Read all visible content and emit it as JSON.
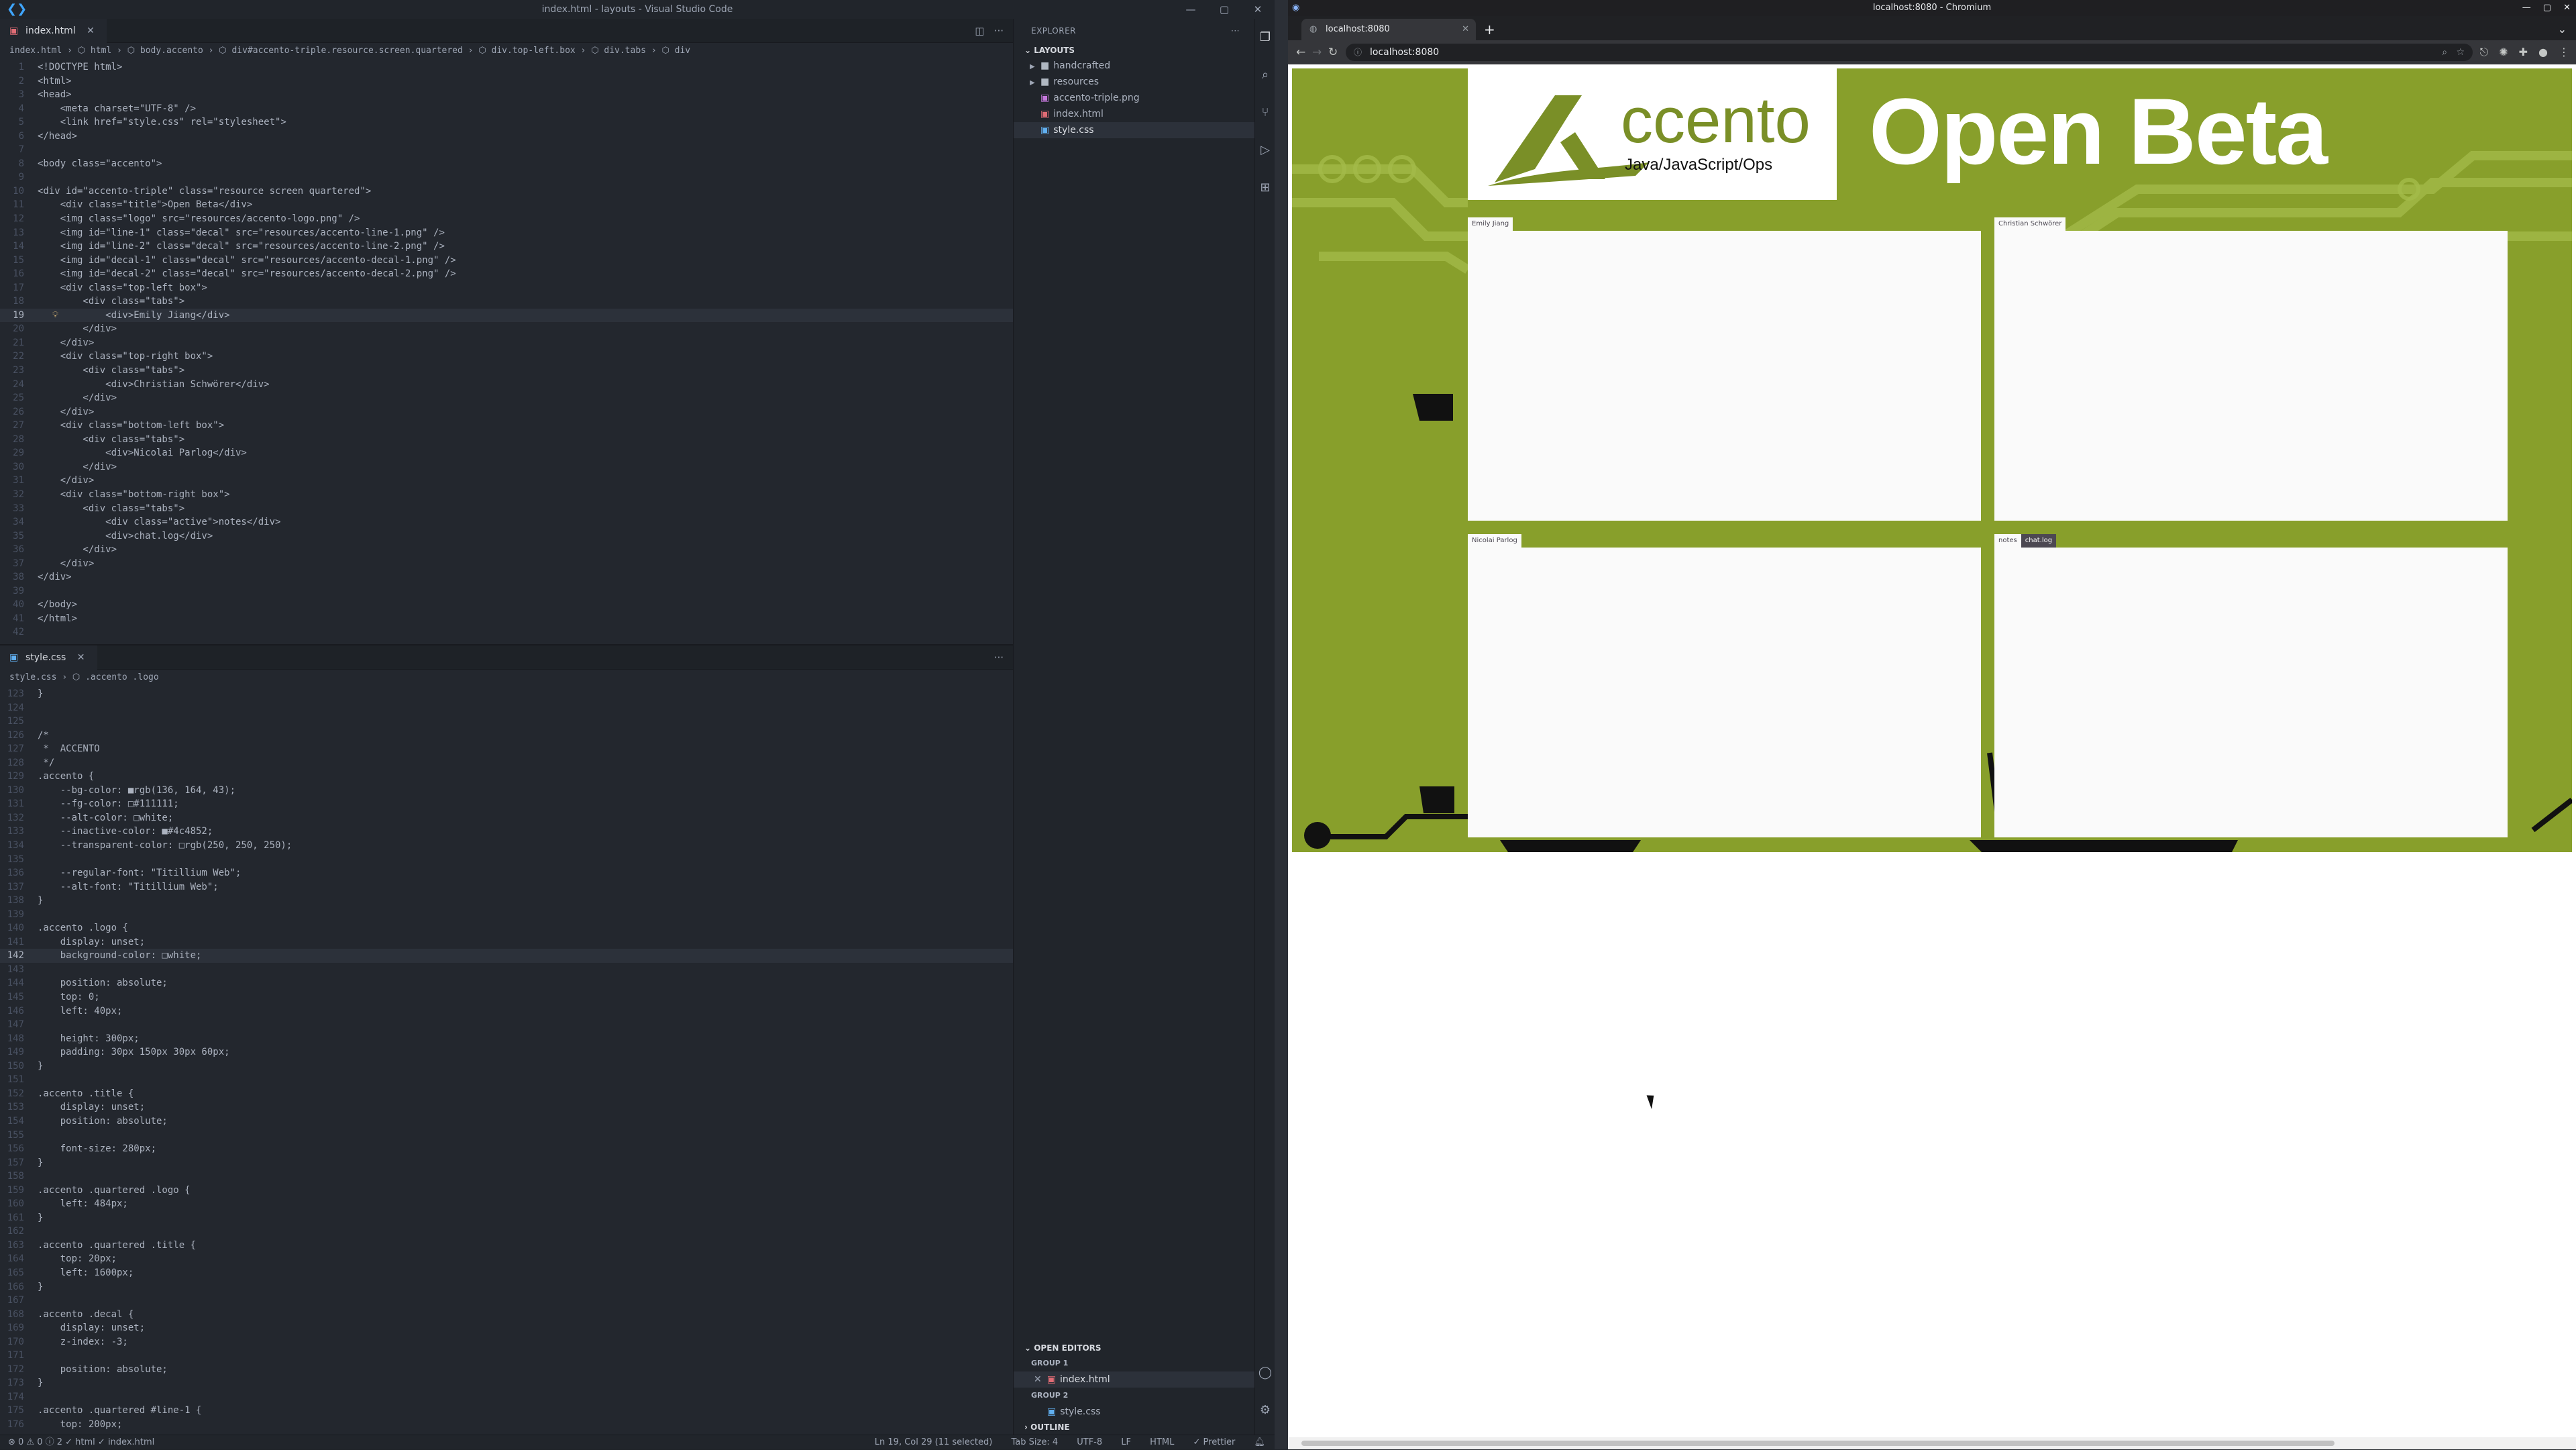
{
  "vscode": {
    "window_title": "index.html - layouts - Visual Studio Code",
    "top_editor": {
      "tab": "index.html",
      "breadcrumbs": "index.html  ›  ⬡ html  ›  ⬡ body.accento  ›  ⬡ div#accento-triple.resource.screen.quartered  ›  ⬡ div.top-left.box  ›  ⬡ div.tabs  ›  ⬡ div",
      "lines": [
        {
          "n": "1",
          "t": "<!DOCTYPE html>"
        },
        {
          "n": "2",
          "t": "<html>"
        },
        {
          "n": "3",
          "t": "<head>"
        },
        {
          "n": "4",
          "t": "    <meta charset=\"UTF-8\" />"
        },
        {
          "n": "5",
          "t": "    <link href=\"style.css\" rel=\"stylesheet\">"
        },
        {
          "n": "6",
          "t": "</head>"
        },
        {
          "n": "7",
          "t": ""
        },
        {
          "n": "8",
          "t": "<body class=\"accento\">"
        },
        {
          "n": "9",
          "t": ""
        },
        {
          "n": "10",
          "t": "<div id=\"accento-triple\" class=\"resource screen quartered\">"
        },
        {
          "n": "11",
          "t": "    <div class=\"title\">Open Beta</div>"
        },
        {
          "n": "12",
          "t": "    <img class=\"logo\" src=\"resources/accento-logo.png\" />"
        },
        {
          "n": "13",
          "t": "    <img id=\"line-1\" class=\"decal\" src=\"resources/accento-line-1.png\" />"
        },
        {
          "n": "14",
          "t": "    <img id=\"line-2\" class=\"decal\" src=\"resources/accento-line-2.png\" />"
        },
        {
          "n": "15",
          "t": "    <img id=\"decal-1\" class=\"decal\" src=\"resources/accento-decal-1.png\" />"
        },
        {
          "n": "16",
          "t": "    <img id=\"decal-2\" class=\"decal\" src=\"resources/accento-decal-2.png\" />"
        },
        {
          "n": "17",
          "t": "    <div class=\"top-left box\">"
        },
        {
          "n": "18",
          "t": "        <div class=\"tabs\">"
        },
        {
          "n": "19",
          "t": "            <div>Emily Jiang</div>"
        },
        {
          "n": "20",
          "t": "        </div>"
        },
        {
          "n": "21",
          "t": "    </div>"
        },
        {
          "n": "22",
          "t": "    <div class=\"top-right box\">"
        },
        {
          "n": "23",
          "t": "        <div class=\"tabs\">"
        },
        {
          "n": "24",
          "t": "            <div>Christian Schwörer</div>"
        },
        {
          "n": "25",
          "t": "        </div>"
        },
        {
          "n": "26",
          "t": "    </div>"
        },
        {
          "n": "27",
          "t": "    <div class=\"bottom-left box\">"
        },
        {
          "n": "28",
          "t": "        <div class=\"tabs\">"
        },
        {
          "n": "29",
          "t": "            <div>Nicolai Parlog</div>"
        },
        {
          "n": "30",
          "t": "        </div>"
        },
        {
          "n": "31",
          "t": "    </div>"
        },
        {
          "n": "32",
          "t": "    <div class=\"bottom-right box\">"
        },
        {
          "n": "33",
          "t": "        <div class=\"tabs\">"
        },
        {
          "n": "34",
          "t": "            <div class=\"active\">notes</div>"
        },
        {
          "n": "35",
          "t": "            <div>chat.log</div>"
        },
        {
          "n": "36",
          "t": "        </div>"
        },
        {
          "n": "37",
          "t": "    </div>"
        },
        {
          "n": "38",
          "t": "</div>"
        },
        {
          "n": "39",
          "t": ""
        },
        {
          "n": "40",
          "t": "</body>"
        },
        {
          "n": "41",
          "t": "</html>"
        },
        {
          "n": "42",
          "t": ""
        }
      ]
    },
    "bottom_editor": {
      "tab": "style.css",
      "breadcrumbs": "style.css  ›  ⬡ .accento .logo",
      "lines": [
        {
          "n": "123",
          "t": "}"
        },
        {
          "n": "124",
          "t": ""
        },
        {
          "n": "125",
          "t": ""
        },
        {
          "n": "126",
          "t": "/*"
        },
        {
          "n": "127",
          "t": " *  ACCENTO"
        },
        {
          "n": "128",
          "t": " */"
        },
        {
          "n": "129",
          "t": ".accento {"
        },
        {
          "n": "130",
          "t": "    --bg-color: ■rgb(136, 164, 43);"
        },
        {
          "n": "131",
          "t": "    --fg-color: □#111111;"
        },
        {
          "n": "132",
          "t": "    --alt-color: □white;"
        },
        {
          "n": "133",
          "t": "    --inactive-color: ■#4c4852;"
        },
        {
          "n": "134",
          "t": "    --transparent-color: □rgb(250, 250, 250);"
        },
        {
          "n": "135",
          "t": ""
        },
        {
          "n": "136",
          "t": "    --regular-font: \"Titillium Web\";"
        },
        {
          "n": "137",
          "t": "    --alt-font: \"Titillium Web\";"
        },
        {
          "n": "138",
          "t": "}"
        },
        {
          "n": "139",
          "t": ""
        },
        {
          "n": "140",
          "t": ".accento .logo {"
        },
        {
          "n": "141",
          "t": "    display: unset;"
        },
        {
          "n": "142",
          "t": "    background-color: □white;"
        },
        {
          "n": "143",
          "t": ""
        },
        {
          "n": "144",
          "t": "    position: absolute;"
        },
        {
          "n": "145",
          "t": "    top: 0;"
        },
        {
          "n": "146",
          "t": "    left: 40px;"
        },
        {
          "n": "147",
          "t": ""
        },
        {
          "n": "148",
          "t": "    height: 300px;"
        },
        {
          "n": "149",
          "t": "    padding: 30px 150px 30px 60px;"
        },
        {
          "n": "150",
          "t": "}"
        },
        {
          "n": "151",
          "t": ""
        },
        {
          "n": "152",
          "t": ".accento .title {"
        },
        {
          "n": "153",
          "t": "    display: unset;"
        },
        {
          "n": "154",
          "t": "    position: absolute;"
        },
        {
          "n": "155",
          "t": ""
        },
        {
          "n": "156",
          "t": "    font-size: 280px;"
        },
        {
          "n": "157",
          "t": "}"
        },
        {
          "n": "158",
          "t": ""
        },
        {
          "n": "159",
          "t": ".accento .quartered .logo {"
        },
        {
          "n": "160",
          "t": "    left: 484px;"
        },
        {
          "n": "161",
          "t": "}"
        },
        {
          "n": "162",
          "t": ""
        },
        {
          "n": "163",
          "t": ".accento .quartered .title {"
        },
        {
          "n": "164",
          "t": "    top: 20px;"
        },
        {
          "n": "165",
          "t": "    left: 1600px;"
        },
        {
          "n": "166",
          "t": "}"
        },
        {
          "n": "167",
          "t": ""
        },
        {
          "n": "168",
          "t": ".accento .decal {"
        },
        {
          "n": "169",
          "t": "    display: unset;"
        },
        {
          "n": "170",
          "t": "    z-index: -3;"
        },
        {
          "n": "171",
          "t": ""
        },
        {
          "n": "172",
          "t": "    position: absolute;"
        },
        {
          "n": "173",
          "t": "}"
        },
        {
          "n": "174",
          "t": ""
        },
        {
          "n": "175",
          "t": ".accento .quartered #line-1 {"
        },
        {
          "n": "176",
          "t": "    top: 200px;"
        }
      ]
    },
    "explorer": {
      "header": "EXPLORER",
      "section": "LAYOUTS",
      "items": [
        {
          "label": "handcrafted",
          "kind": "folder"
        },
        {
          "label": "resources",
          "kind": "folder"
        },
        {
          "label": "accento-triple.png",
          "kind": "file"
        },
        {
          "label": "index.html",
          "kind": "file"
        },
        {
          "label": "style.css",
          "kind": "file"
        }
      ],
      "open_editors": "OPEN EDITORS",
      "group1": "GROUP 1",
      "group1_file": "index.html",
      "group2": "GROUP 2",
      "group2_file": "style.css",
      "outline": "OUTLINE"
    },
    "status": {
      "left": "⊗ 0 ⚠ 0 ⓘ 2   ✓ html  ✓ index.html",
      "position": "Ln 19, Col 29 (11 selected)",
      "tab_size": "Tab Size: 4",
      "encoding": "UTF-8",
      "eol": "LF",
      "language": "HTML",
      "formatter": "✓ Prettier"
    }
  },
  "chromium": {
    "window_title": "localhost:8080 - Chromium",
    "tab_title": "localhost:8080",
    "url": "localhost:8080",
    "page": {
      "title": "Open Beta",
      "logo_text": "ccento",
      "logo_sub": "Java/JavaScript/Ops",
      "boxes": {
        "top_left": "Emily Jiang",
        "top_right": "Christian Schwörer",
        "bottom_left": "Nicolai Parlog",
        "bottom_right_active": "notes",
        "bottom_right_inactive": "chat.log"
      }
    }
  }
}
